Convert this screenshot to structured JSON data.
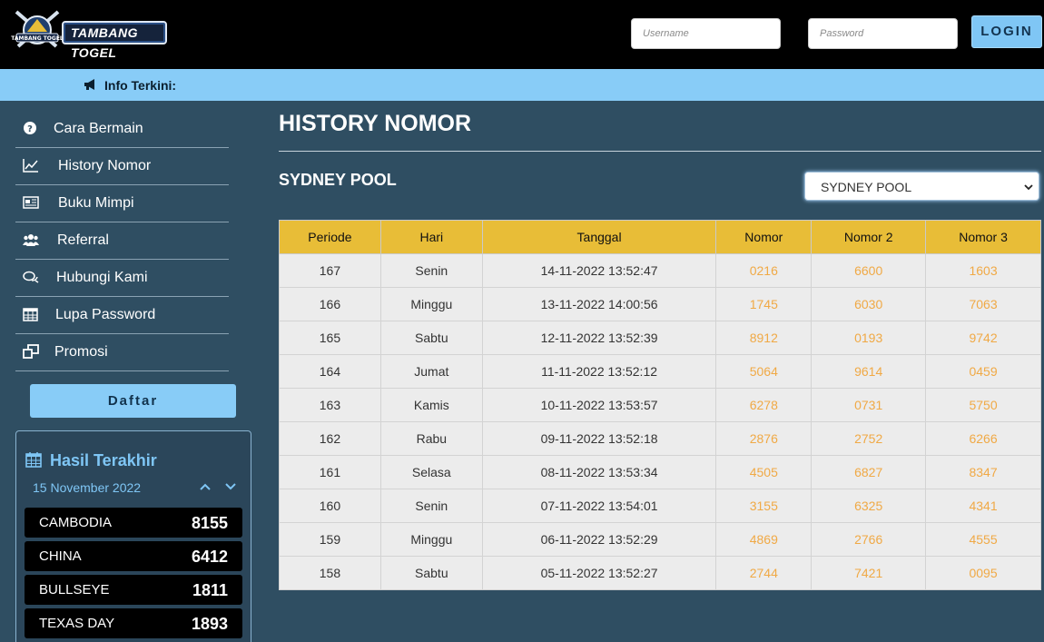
{
  "brand": {
    "logo_text": "TAMBANG TOGEL",
    "emblem_text": "TAMBANG TOGEL"
  },
  "login": {
    "username_placeholder": "Username",
    "password_placeholder": "Password",
    "login_label": "LOGIN"
  },
  "info": {
    "label": "Info Terkini:"
  },
  "sidebar": {
    "items": [
      {
        "label": "Cara Bermain",
        "icon": "question-circle-icon"
      },
      {
        "label": "History Nomor",
        "icon": "line-chart-icon"
      },
      {
        "label": "Buku Mimpi",
        "icon": "newspaper-icon"
      },
      {
        "label": "Referral",
        "icon": "users-icon"
      },
      {
        "label": "Hubungi Kami",
        "icon": "chat-bubbles-icon"
      },
      {
        "label": "Lupa Password",
        "icon": "calendar-icon"
      },
      {
        "label": "Promosi",
        "icon": "windows-icon"
      }
    ],
    "daftar_label": "Daftar"
  },
  "results": {
    "title": "Hasil Terakhir",
    "date": "15 November 2022",
    "rows": [
      {
        "name": "CAMBODIA",
        "value": "8155"
      },
      {
        "name": "CHINA",
        "value": "6412"
      },
      {
        "name": "BULLSEYE",
        "value": "1811"
      },
      {
        "name": "TEXAS DAY",
        "value": "1893"
      }
    ]
  },
  "main": {
    "title": "HISTORY NOMOR",
    "pool_title": "SYDNEY POOL",
    "pool_selected": "SYDNEY POOL",
    "table": {
      "headers": [
        "Periode",
        "Hari",
        "Tanggal",
        "Nomor",
        "Nomor 2",
        "Nomor 3"
      ],
      "rows": [
        [
          "167",
          "Senin",
          "14-11-2022 13:52:47",
          "0216",
          "6600",
          "1603"
        ],
        [
          "166",
          "Minggu",
          "13-11-2022 14:00:56",
          "1745",
          "6030",
          "7063"
        ],
        [
          "165",
          "Sabtu",
          "12-11-2022 13:52:39",
          "8912",
          "0193",
          "9742"
        ],
        [
          "164",
          "Jumat",
          "11-11-2022 13:52:12",
          "5064",
          "9614",
          "0459"
        ],
        [
          "163",
          "Kamis",
          "10-11-2022 13:53:57",
          "6278",
          "0731",
          "5750"
        ],
        [
          "162",
          "Rabu",
          "09-11-2022 13:52:18",
          "2876",
          "2752",
          "6266"
        ],
        [
          "161",
          "Selasa",
          "08-11-2022 13:53:34",
          "4505",
          "6827",
          "8347"
        ],
        [
          "160",
          "Senin",
          "07-11-2022 13:54:01",
          "3155",
          "6325",
          "4341"
        ],
        [
          "159",
          "Minggu",
          "06-11-2022 13:52:29",
          "4869",
          "2766",
          "4555"
        ],
        [
          "158",
          "Sabtu",
          "05-11-2022 13:52:27",
          "2744",
          "7421",
          "0095"
        ]
      ]
    }
  },
  "colors": {
    "header_bg": "#000000",
    "accent": "#88ccf7",
    "page_bg": "#2f4e62",
    "table_header": "#e8bd37",
    "number_text": "#f0a945"
  }
}
